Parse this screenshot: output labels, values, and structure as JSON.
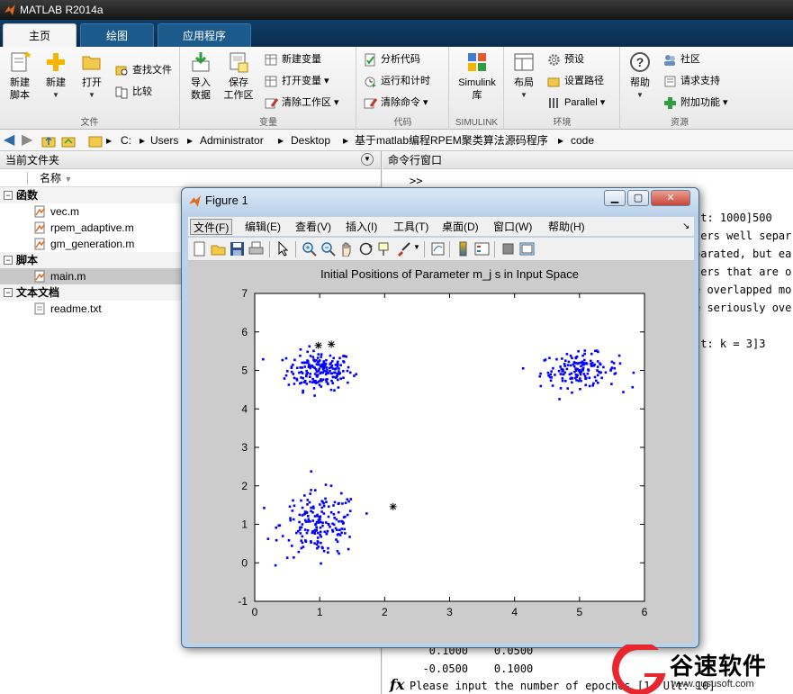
{
  "app": {
    "title": "MATLAB R2014a"
  },
  "tabs": [
    {
      "label": "主页"
    },
    {
      "label": "绘图"
    },
    {
      "label": "应用程序"
    }
  ],
  "ribbon": {
    "file": {
      "section": "文件",
      "new_script": "新建\n脚本",
      "new": "新建",
      "open": "打开",
      "find_files": "查找文件",
      "compare": "比较"
    },
    "variable": {
      "section": "变量",
      "import_data": "导入\n数据",
      "save_workspace": "保存\n工作区",
      "new_variable": "新建变量",
      "open_variable": "打开变量",
      "clear_workspace": "清除工作区"
    },
    "code": {
      "section": "代码",
      "analyze_code": "分析代码",
      "run_and_time": "运行和计时",
      "clear_commands": "清除命令"
    },
    "simulink": {
      "section": "SIMULINK",
      "library": "Simulink\n库"
    },
    "environment": {
      "section": "环境",
      "layout": "布局",
      "preferences": "预设",
      "set_path": "设置路径",
      "parallel": "Parallel"
    },
    "resources": {
      "section": "资源",
      "help": "帮助",
      "community": "社区",
      "request_support": "请求支持",
      "addons": "附加功能"
    }
  },
  "address": {
    "parts": [
      "C:",
      "Users",
      "Administrator",
      "Desktop",
      "基于matlab编程RPEM聚类算法源码程序",
      "code"
    ]
  },
  "current_folder": {
    "title": "当前文件夹",
    "name_col": "名称",
    "groups": [
      {
        "label": "函数",
        "files": [
          "vec.m",
          "rpem_adaptive.m",
          "gm_generation.m"
        ]
      },
      {
        "label": "脚本",
        "files": [
          "main.m"
        ]
      },
      {
        "label": "文本文档",
        "files": [
          "readme.txt"
        ]
      }
    ]
  },
  "command_window": {
    "title": "命令行窗口",
    "prompt": ">>",
    "lines": [
      "lt: 1000]500",
      "ters well separ",
      "parated, but ea",
      "ters that are o",
      "e overlapped mo",
      "e seriously ove",
      "",
      "lt: k = 3]3"
    ],
    "bottom_lines": [
      "   0.1000    0.0500",
      "  -0.0500    0.1000"
    ],
    "fx_line": "Please input the number of epoches [1  Ult: 10]"
  },
  "figure": {
    "title": "Figure 1",
    "menus": [
      "文件(F)",
      "编辑(E)",
      "查看(V)",
      "插入(I)",
      "工具(T)",
      "桌面(D)",
      "窗口(W)",
      "帮助(H)"
    ]
  },
  "chart_data": {
    "type": "scatter",
    "title": "Initial Positions of Parameter m_j s in Input Space",
    "xlim": [
      0,
      6
    ],
    "ylim": [
      -1,
      7
    ],
    "xticks": [
      0,
      1,
      2,
      3,
      4,
      5,
      6
    ],
    "yticks": [
      -1,
      0,
      1,
      2,
      3,
      4,
      5,
      6,
      7
    ],
    "point_color": "#0000ff",
    "marker_color": "#000000",
    "clusters": [
      {
        "center": [
          1.0,
          5.0
        ],
        "sd": [
          0.25,
          0.25
        ],
        "n": 190
      },
      {
        "center": [
          5.0,
          5.0
        ],
        "sd": [
          0.3,
          0.22
        ],
        "n": 150
      },
      {
        "center": [
          1.0,
          1.0
        ],
        "sd": [
          0.3,
          0.42
        ],
        "n": 180
      }
    ],
    "initial_centers": [
      [
        0.98,
        5.65
      ],
      [
        1.18,
        5.68
      ],
      [
        2.13,
        1.46
      ]
    ]
  },
  "watermark": {
    "text": "谷速软件",
    "url": "www.gususoft.com"
  }
}
